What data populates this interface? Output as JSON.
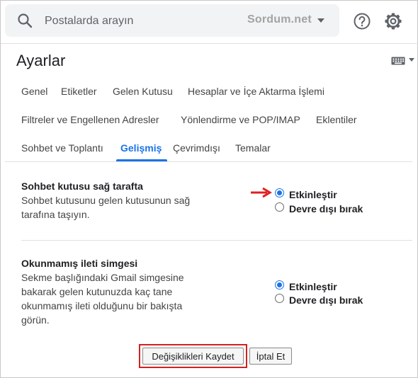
{
  "search": {
    "placeholder": "Postalarda arayın",
    "watermark": "Sordum.net"
  },
  "header": {
    "title": "Ayarlar"
  },
  "tabs": [
    {
      "label": "Genel",
      "active": false
    },
    {
      "label": "Etiketler",
      "active": false
    },
    {
      "label": "Gelen Kutusu",
      "active": false
    },
    {
      "label": "Hesaplar ve İçe Aktarma İşlemi",
      "active": false
    },
    {
      "label": "Filtreler ve Engellenen Adresler",
      "active": false
    },
    {
      "label": "Yönlendirme ve POP/IMAP",
      "active": false
    },
    {
      "label": "Eklentiler",
      "active": false
    },
    {
      "label": "Sohbet ve Toplantı",
      "active": false
    },
    {
      "label": "Gelişmiş",
      "active": true
    },
    {
      "label": "Çevrimdışı",
      "active": false
    },
    {
      "label": "Temalar",
      "active": false
    }
  ],
  "settings": [
    {
      "title": "Sohbet kutusu sağ tarafta",
      "description": "Sohbet kutusunu gelen kutusunun sağ tarafına taşıyın.",
      "options": [
        {
          "label": "Etkinleştir",
          "selected": true
        },
        {
          "label": "Devre dışı bırak",
          "selected": false
        }
      ]
    },
    {
      "title": "Okunmamış ileti simgesi",
      "description": "Sekme başlığındaki Gmail simgesine bakarak gelen kutunuzda kaç tane okunmamış ileti olduğunu bir bakışta görün.",
      "options": [
        {
          "label": "Etkinleştir",
          "selected": true
        },
        {
          "label": "Devre dışı bırak",
          "selected": false
        }
      ]
    }
  ],
  "actions": {
    "save_label": "Değişiklikleri Kaydet",
    "cancel_label": "İptal Et"
  },
  "colors": {
    "accent": "#1a73e8",
    "annotation_red": "#d32020"
  },
  "icons": {
    "search": "search-icon",
    "search_options": "caret-down-icon",
    "help": "help-icon",
    "settings": "gear-icon",
    "keyboard": "keyboard-icon",
    "annotation": "red-arrow-icon"
  }
}
